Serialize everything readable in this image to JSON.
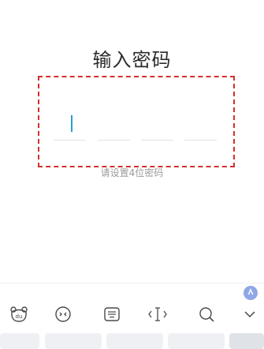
{
  "title": "输入密码",
  "hint": "请设置4位密码",
  "pin": {
    "length": 4,
    "filled": 0
  },
  "toolbar": {
    "icons": [
      "bear-logo-icon",
      "emoji-icon",
      "keyboard-icon",
      "cursor-move-icon",
      "search-icon",
      "collapse-chevron-icon"
    ]
  },
  "colors": {
    "accent": "#2a9bd6",
    "highlight_border": "#d32f2f"
  }
}
